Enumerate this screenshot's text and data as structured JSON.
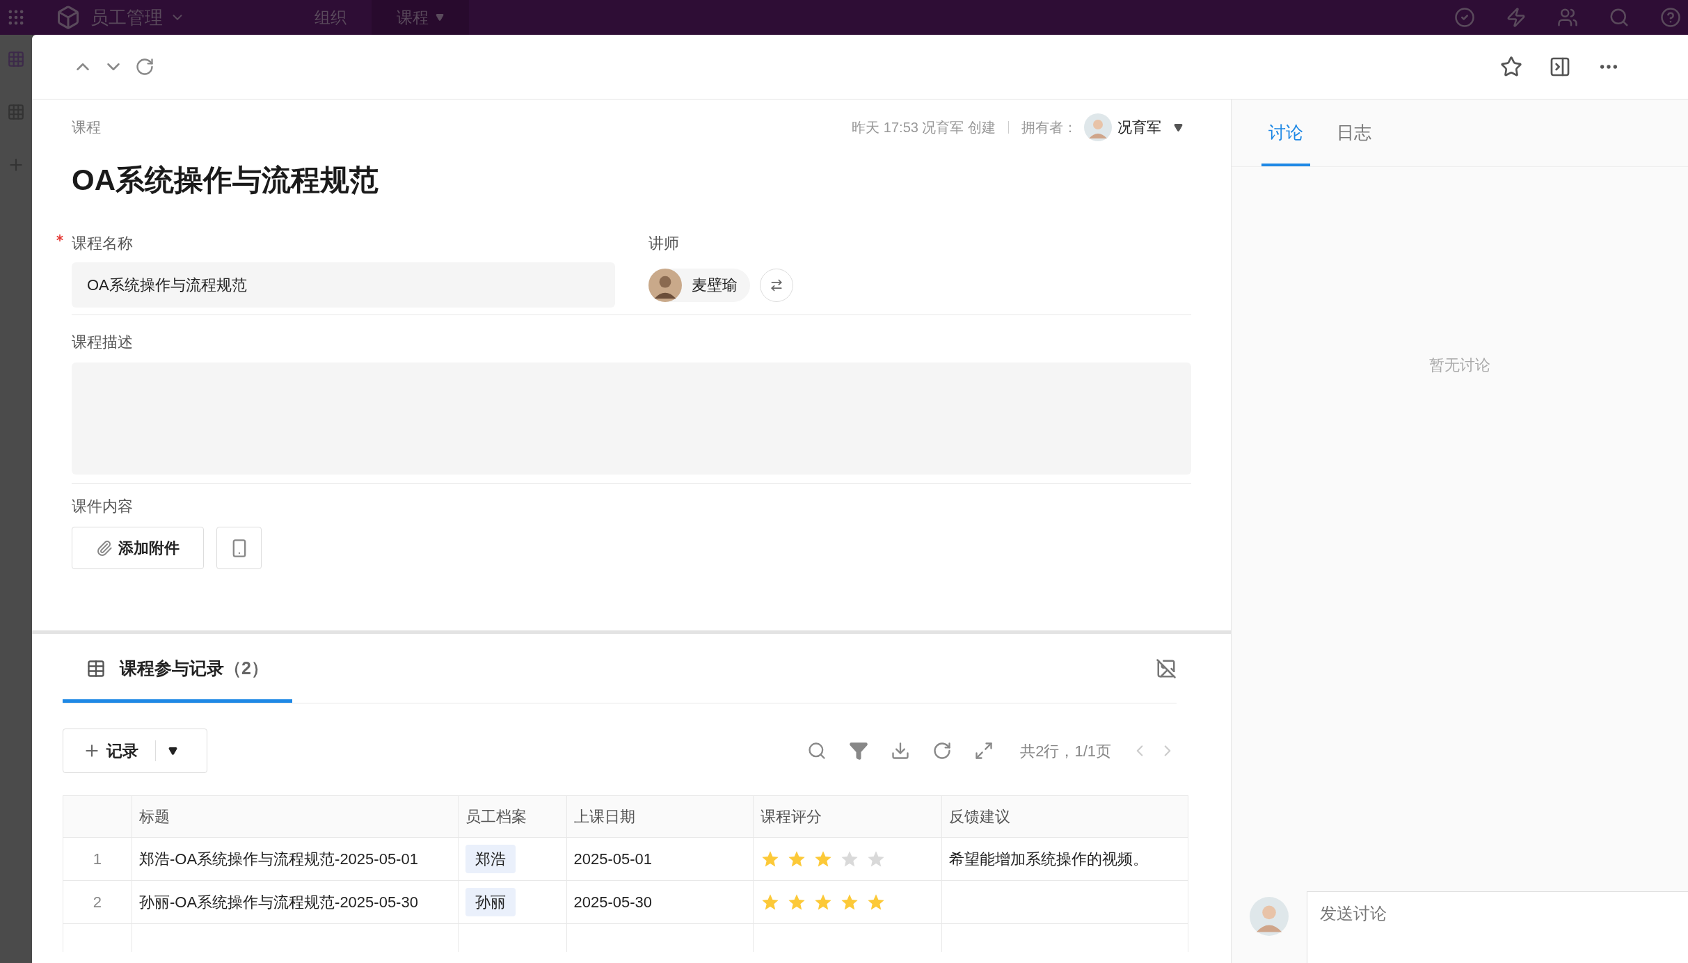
{
  "topbar": {
    "app_name": "员工管理",
    "tabs": [
      {
        "label": "组织",
        "selected": false
      },
      {
        "label": "课程",
        "selected": true
      }
    ]
  },
  "record": {
    "breadcrumb": "课程",
    "meta": "昨天 17:53 况育军 创建",
    "owner_label": "拥有者：",
    "owner": "况育军",
    "title": "OA系统操作与流程规范"
  },
  "fields": {
    "name": {
      "label": "课程名称",
      "required": true,
      "value": "OA系统操作与流程规范"
    },
    "teacher": {
      "label": "讲师",
      "value": "麦壁瑜"
    },
    "description": {
      "label": "课程描述"
    },
    "attachments": {
      "label": "课件内容",
      "button": "添加附件"
    }
  },
  "side_tabs": [
    {
      "label": "讨论",
      "selected": true
    },
    {
      "label": "日志",
      "selected": false
    }
  ],
  "discussion": {
    "empty_text": "暂无讨论",
    "placeholder": "发送讨论"
  },
  "related": {
    "tab": "课程参与记录",
    "count": "（2）",
    "add_button": "记录",
    "pagination": "共2行，1/1页",
    "columns": [
      "标题",
      "员工档案",
      "上课日期",
      "课程评分",
      "反馈建议"
    ],
    "rows": [
      {
        "index": "1",
        "title": "郑浩-OA系统操作与流程规范-2025-05-01",
        "employee": "郑浩",
        "date": "2025-05-01",
        "stars": 3,
        "feedback": "希望能增加系统操作的视频。"
      },
      {
        "index": "2",
        "title": "孙丽-OA系统操作与流程规范-2025-05-30",
        "employee": "孙丽",
        "date": "2025-05-30",
        "stars": 5
      }
    ]
  }
}
